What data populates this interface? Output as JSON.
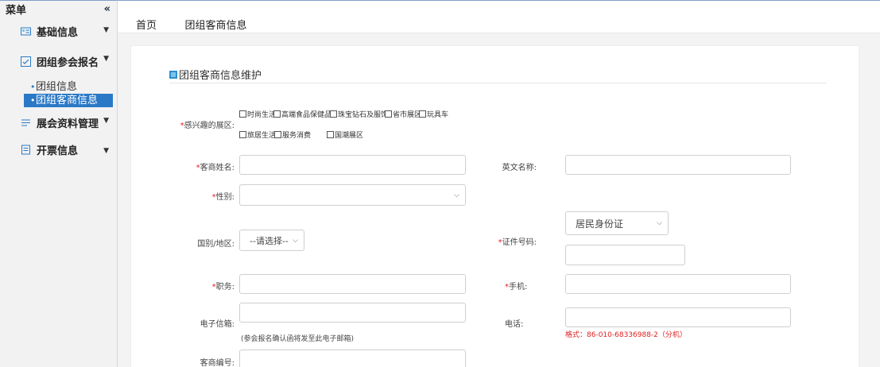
{
  "sidebar": {
    "title": "菜单",
    "collapse": "«",
    "groups": [
      {
        "label": "基础信息"
      },
      {
        "label": "团组参会报名",
        "items": [
          "团组信息",
          "团组客商信息"
        ]
      },
      {
        "label": "展会资料管理"
      },
      {
        "label": "开票信息"
      }
    ]
  },
  "tabs": [
    "首页",
    "团组客商信息"
  ],
  "form": {
    "title": "团组客商信息维护",
    "req": "*",
    "interest_label": "感兴趣的展区:",
    "interests": [
      "时尚生活",
      "高端食品保健品",
      "珠宝钻石及服饰",
      "省市展区",
      "玩具车",
      "旅居生活",
      "服务消费",
      "国潮展区"
    ],
    "name_label": "客商姓名:",
    "en_name_label": "英文名称:",
    "gender_label": "性别:",
    "country_label": "国别/地区:",
    "country_value": "--请选择--",
    "id_label": "证件号码:",
    "id_type_value": "居民身份证",
    "position_label": "职务:",
    "mobile_label": "手机:",
    "email_label": "电子信箱:",
    "email_hint": "(参会报名确认函将发至此电子邮箱)",
    "phone_label": "电话:",
    "phone_hint": "格式：86-010-68336988-2（分机）",
    "customer_no_label": "客商编号:"
  },
  "colors": {
    "accent": "#2a79c6",
    "required": "#e02020",
    "tab_underline": "#c0392b"
  }
}
